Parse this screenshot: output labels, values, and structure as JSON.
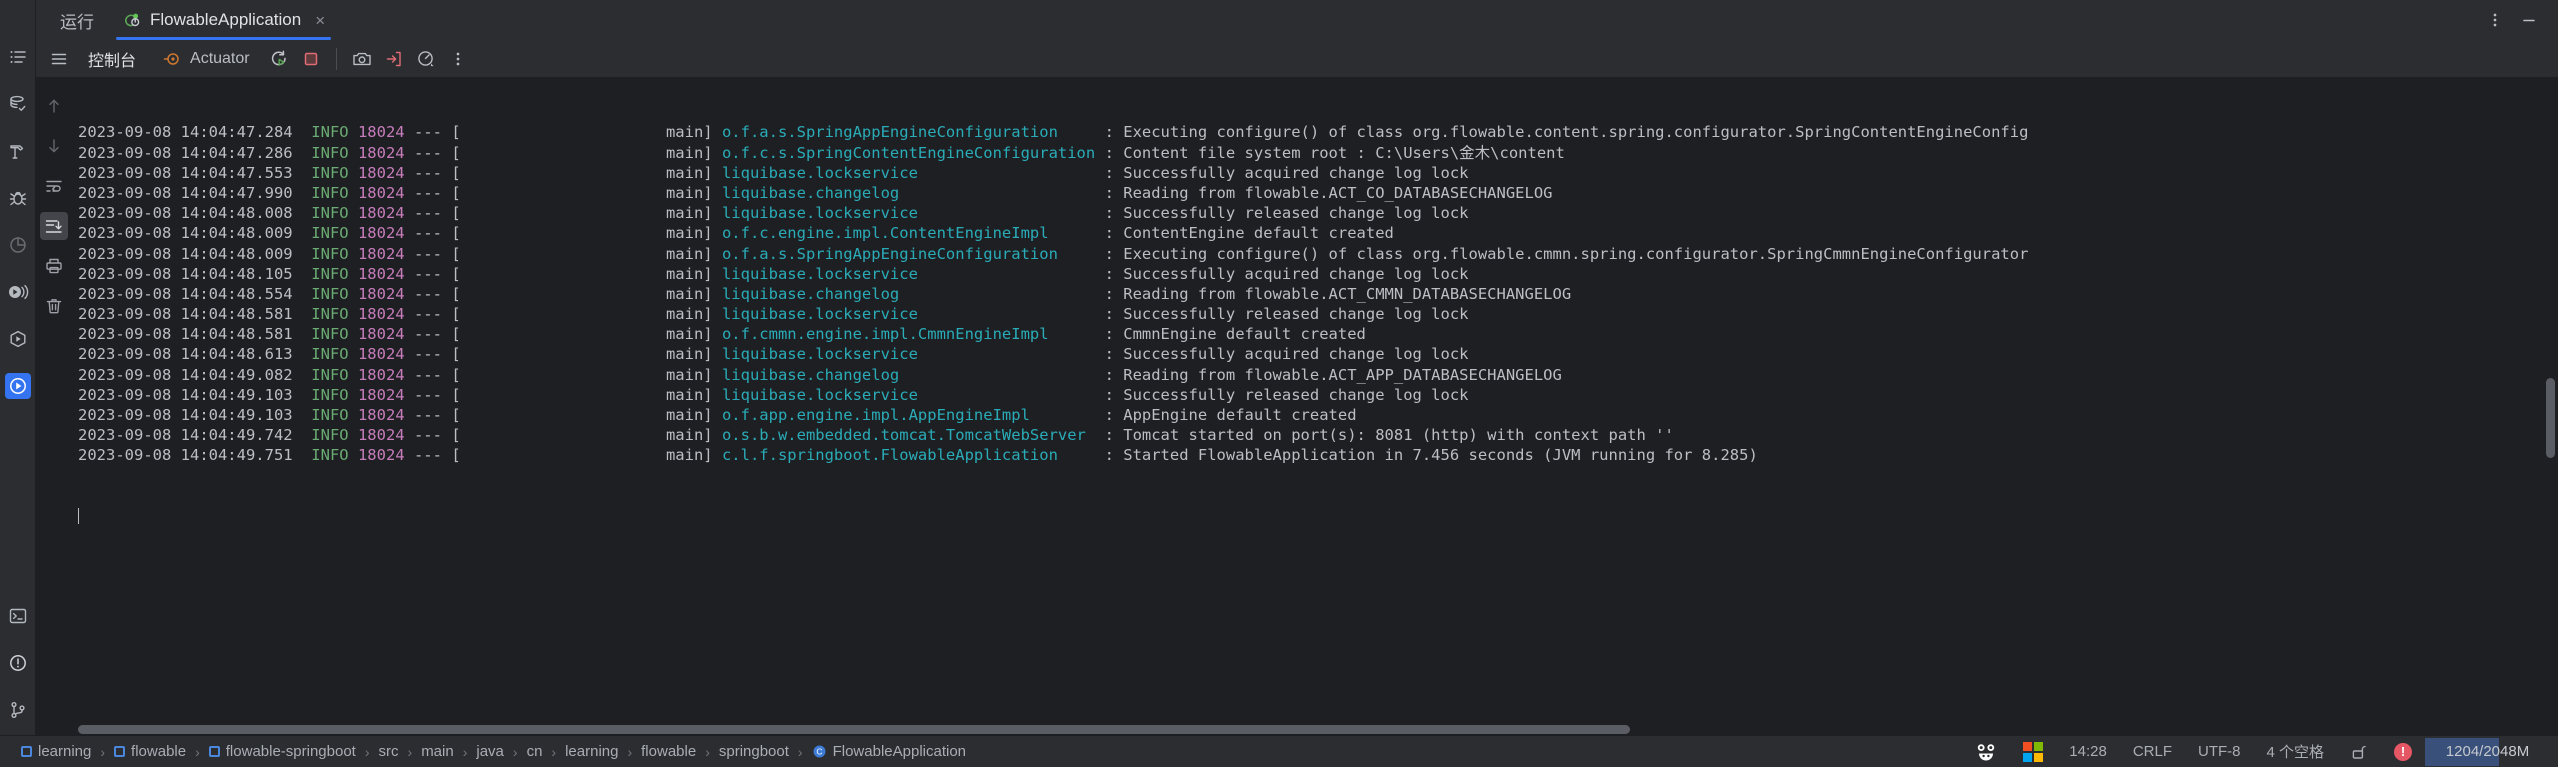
{
  "window": {
    "tool_window_title": "运行",
    "more_options_icon": "vertical-dots-icon",
    "minimize_icon": "minimize-icon"
  },
  "tabs": [
    {
      "label": "FlowableApplication",
      "icon": "spring-boot-run-icon",
      "close_label": "×",
      "selected": true
    }
  ],
  "toolbar": {
    "menu_icon": "hamburger-menu-icon",
    "console_tab": "控制台",
    "actuator_tab": "Actuator",
    "actuator_icon": "actuator-target-icon",
    "rerun_icon": "rerun-icon",
    "stop_icon": "stop-icon",
    "camera_icon": "camera-icon",
    "export_icon": "export-to-file-icon",
    "gauge_icon": "gauge-icon",
    "more_icon": "vertical-dots-icon"
  },
  "console_gutter": [
    {
      "icon": "scroll-up-icon",
      "state": "dim"
    },
    {
      "icon": "scroll-down-icon",
      "state": "dim"
    },
    {
      "icon": "soft-wrap-icon",
      "state": "normal"
    },
    {
      "icon": "scroll-to-end-icon",
      "state": "toggled"
    },
    {
      "icon": "print-icon",
      "state": "normal"
    },
    {
      "icon": "clear-all-icon",
      "state": "normal"
    }
  ],
  "left_stripe": [
    {
      "icon": "structure-list-icon",
      "state": "normal"
    },
    {
      "icon": "database-check-icon",
      "state": "normal"
    },
    {
      "icon": "build-hammer-icon",
      "state": "normal"
    },
    {
      "icon": "debug-bug-icon",
      "state": "normal"
    },
    {
      "icon": "profiler-pie-icon",
      "state": "dim"
    },
    {
      "icon": "run-dashboard-icon",
      "state": "normal"
    },
    {
      "icon": "services-play-icon",
      "state": "normal"
    },
    {
      "icon": "run-window-icon",
      "state": "active"
    },
    {
      "icon": "terminal-icon",
      "state": "normal"
    },
    {
      "icon": "problems-warning-icon",
      "state": "normal"
    },
    {
      "icon": "version-control-icon",
      "state": "normal"
    }
  ],
  "console": {
    "lines": [
      {
        "ts": "2023-09-08 14:04:47.284",
        "level": "INFO",
        "pid": "18024",
        "thread": "main",
        "logger": "o.f.a.s.SpringAppEngineConfiguration",
        "message": "Executing configure() of class org.flowable.content.spring.configurator.SpringContentEngineConfig"
      },
      {
        "ts": "2023-09-08 14:04:47.286",
        "level": "INFO",
        "pid": "18024",
        "thread": "main",
        "logger": "o.f.c.s.SpringContentEngineConfiguration",
        "message": "Content file system root : C:\\Users\\金木\\content"
      },
      {
        "ts": "2023-09-08 14:04:47.553",
        "level": "INFO",
        "pid": "18024",
        "thread": "main",
        "logger": "liquibase.lockservice",
        "message": "Successfully acquired change log lock"
      },
      {
        "ts": "2023-09-08 14:04:47.990",
        "level": "INFO",
        "pid": "18024",
        "thread": "main",
        "logger": "liquibase.changelog",
        "message": "Reading from flowable.ACT_CO_DATABASECHANGELOG"
      },
      {
        "ts": "2023-09-08 14:04:48.008",
        "level": "INFO",
        "pid": "18024",
        "thread": "main",
        "logger": "liquibase.lockservice",
        "message": "Successfully released change log lock"
      },
      {
        "ts": "2023-09-08 14:04:48.009",
        "level": "INFO",
        "pid": "18024",
        "thread": "main",
        "logger": "o.f.c.engine.impl.ContentEngineImpl",
        "message": "ContentEngine default created"
      },
      {
        "ts": "2023-09-08 14:04:48.009",
        "level": "INFO",
        "pid": "18024",
        "thread": "main",
        "logger": "o.f.a.s.SpringAppEngineConfiguration",
        "message": "Executing configure() of class org.flowable.cmmn.spring.configurator.SpringCmmnEngineConfigurator"
      },
      {
        "ts": "2023-09-08 14:04:48.105",
        "level": "INFO",
        "pid": "18024",
        "thread": "main",
        "logger": "liquibase.lockservice",
        "message": "Successfully acquired change log lock"
      },
      {
        "ts": "2023-09-08 14:04:48.554",
        "level": "INFO",
        "pid": "18024",
        "thread": "main",
        "logger": "liquibase.changelog",
        "message": "Reading from flowable.ACT_CMMN_DATABASECHANGELOG"
      },
      {
        "ts": "2023-09-08 14:04:48.581",
        "level": "INFO",
        "pid": "18024",
        "thread": "main",
        "logger": "liquibase.lockservice",
        "message": "Successfully released change log lock"
      },
      {
        "ts": "2023-09-08 14:04:48.581",
        "level": "INFO",
        "pid": "18024",
        "thread": "main",
        "logger": "o.f.cmmn.engine.impl.CmmnEngineImpl",
        "message": "CmmnEngine default created"
      },
      {
        "ts": "2023-09-08 14:04:48.613",
        "level": "INFO",
        "pid": "18024",
        "thread": "main",
        "logger": "liquibase.lockservice",
        "message": "Successfully acquired change log lock"
      },
      {
        "ts": "2023-09-08 14:04:49.082",
        "level": "INFO",
        "pid": "18024",
        "thread": "main",
        "logger": "liquibase.changelog",
        "message": "Reading from flowable.ACT_APP_DATABASECHANGELOG"
      },
      {
        "ts": "2023-09-08 14:04:49.103",
        "level": "INFO",
        "pid": "18024",
        "thread": "main",
        "logger": "liquibase.lockservice",
        "message": "Successfully released change log lock"
      },
      {
        "ts": "2023-09-08 14:04:49.103",
        "level": "INFO",
        "pid": "18024",
        "thread": "main",
        "logger": "o.f.app.engine.impl.AppEngineImpl",
        "message": "AppEngine default created"
      },
      {
        "ts": "2023-09-08 14:04:49.742",
        "level": "INFO",
        "pid": "18024",
        "thread": "main",
        "logger": "o.s.b.w.embedded.tomcat.TomcatWebServer",
        "message": "Tomcat started on port(s): 8081 (http) with context path ''"
      },
      {
        "ts": "2023-09-08 14:04:49.751",
        "level": "INFO",
        "pid": "18024",
        "thread": "main",
        "logger": "c.l.f.springboot.FlowableApplication",
        "message": "Started FlowableApplication in 7.456 seconds (JVM running for 8.285)"
      }
    ],
    "separator": "---",
    "colon": ":"
  },
  "status_bar": {
    "breadcrumbs": [
      {
        "label": "learning",
        "module": true
      },
      {
        "label": "flowable",
        "module": true
      },
      {
        "label": "flowable-springboot",
        "module": true
      },
      {
        "label": "src",
        "module": false
      },
      {
        "label": "main",
        "module": false
      },
      {
        "label": "java",
        "module": false
      },
      {
        "label": "cn",
        "module": false
      },
      {
        "label": "learning",
        "module": false
      },
      {
        "label": "flowable",
        "module": false
      },
      {
        "label": "springboot",
        "module": false
      },
      {
        "label": "FlowableApplication",
        "module": false,
        "icon": "java-class-icon"
      }
    ],
    "separator": "›",
    "right": {
      "panda_icon": "panda-icon",
      "ms_logo_icon": "microsoft-logo-icon",
      "time": "14:28",
      "line_separator": "CRLF",
      "encoding": "UTF-8",
      "indent": "4 个空格",
      "lock_icon": "unlocked-lock-icon",
      "error_icon": "error-badge-icon",
      "error_count": "!",
      "memory": "1204/2048M"
    }
  },
  "colors": {
    "accent_blue": "#3574f0",
    "log_level_info": "#6aab73",
    "log_pid": "#c77dbb",
    "log_logger": "#2aacb8",
    "log_text": "#bcbec4",
    "panel_bg": "#2b2d30",
    "console_bg": "#1e1f22",
    "error_red": "#e55765",
    "memory_fill": "#39507a"
  }
}
